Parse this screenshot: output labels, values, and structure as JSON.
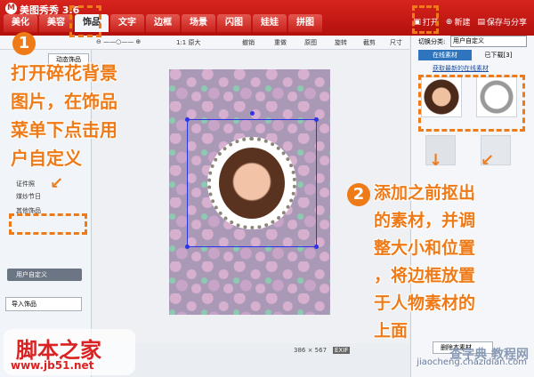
{
  "app": {
    "title": "美图秀秀 3.6",
    "logo": "M"
  },
  "tabs": [
    "美化",
    "美容",
    "饰品",
    "文字",
    "边框",
    "场景",
    "闪图",
    "娃娃",
    "拼图"
  ],
  "top_actions": {
    "open": "打开",
    "new": "新建",
    "save": "保存与分享"
  },
  "toolbar": {
    "zoom_label": "1:1 原大",
    "undo": "撤销",
    "redo": "重做",
    "original": "原图",
    "rotate": "旋转",
    "crop": "截剪",
    "size": "尺寸"
  },
  "left": {
    "subtab": "动态饰品",
    "categories": [
      "证件照",
      "煤炒节日",
      "其他饰品"
    ],
    "selected": "用户自定义",
    "import": "导入饰品"
  },
  "status": {
    "dims": "386 × 567",
    "zoom": "EXIF"
  },
  "right": {
    "switch_label": "切换分类:",
    "category": "用户自定义",
    "tabs": [
      "在线素材",
      "已下载[3]"
    ],
    "link": "获取最新的在线素材",
    "delete": "删除本素材"
  },
  "annotations": {
    "step1": "1",
    "step1_text": [
      "打开碎花背景",
      "图片，在饰品",
      "菜单下点击用",
      "户自定义"
    ],
    "step2": "2",
    "step2_text": [
      "添加之前抠出",
      "的素材，并调",
      "整大小和位置",
      "，将边框放置",
      "于人物素材的",
      "上面"
    ]
  },
  "watermark": {
    "left_title": "脚本之家",
    "left_url": "www.jb51.net",
    "right_top": "查字典 教程网",
    "right_url": "jiaocheng.chazidian.com"
  }
}
